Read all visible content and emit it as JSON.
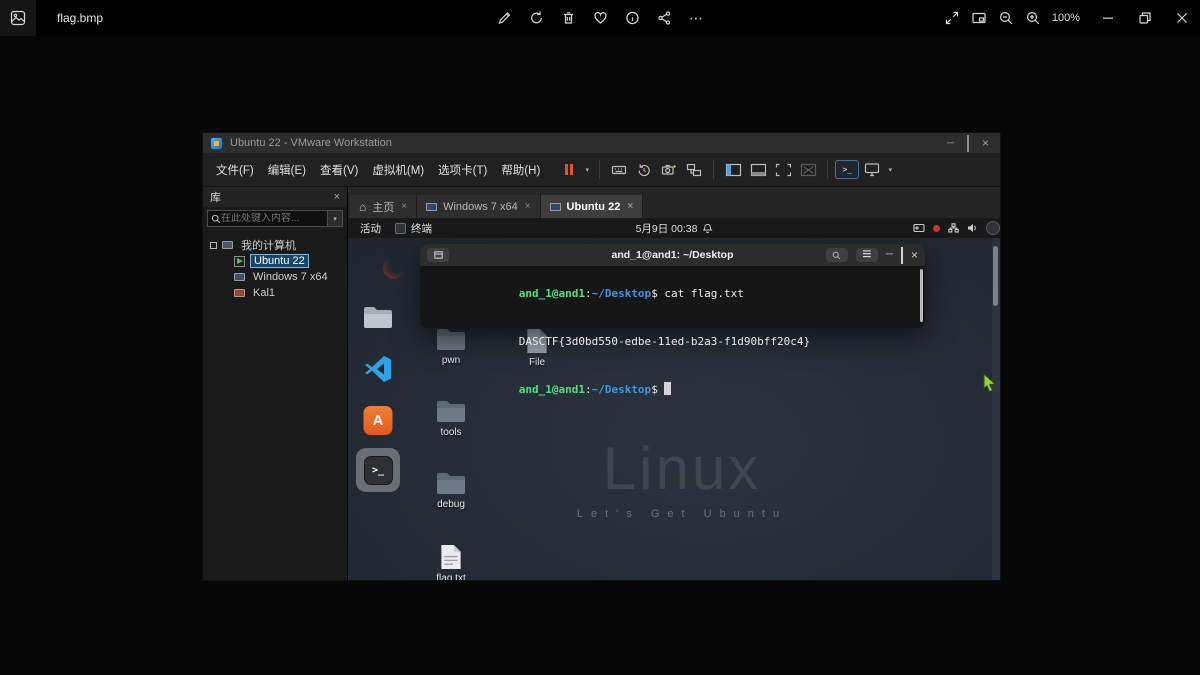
{
  "photos": {
    "title": "flag.bmp",
    "zoom_level": "100%"
  },
  "glyphs": {
    "more": "⋯",
    "caret": "▾",
    "home": "⌂",
    "tab_close": "×",
    "win_min": "─",
    "win_close": "×",
    "menu_icon": "≡",
    "prompt_icon": ">_",
    "lib_close": "×"
  },
  "vmware": {
    "title": "Ubuntu 22 - VMware Workstation",
    "menus": [
      "文件(F)",
      "编辑(E)",
      "查看(V)",
      "虚拟机(M)",
      "选项卡(T)",
      "帮助(H)"
    ],
    "sidebar": {
      "header": "库",
      "search_placeholder": "在此处键入内容...",
      "root": "我的计算机",
      "vms": [
        {
          "name": "Ubuntu 22",
          "state": "running",
          "selected": true
        },
        {
          "name": "Windows 7 x64"
        },
        {
          "name": "Kal1"
        }
      ]
    },
    "tabs": [
      {
        "label": "主页"
      },
      {
        "label": "Windows 7 x64"
      },
      {
        "label": "Ubuntu 22",
        "active": true
      }
    ]
  },
  "ubuntu": {
    "topbar": {
      "activities": "活动",
      "app_name": "终端",
      "clock": "5月9日 00:38"
    },
    "watermark": {
      "title": "Linux",
      "subtitle": "Let's Get Ubuntu"
    },
    "desktop_icons": [
      "pwn",
      "File",
      "tools",
      "debug",
      "flag.txt"
    ],
    "dock": [
      "firefox",
      "files",
      "vscode",
      "ubuntu-software",
      "terminal",
      "disc",
      "app"
    ],
    "terminal": {
      "title": "and_1@and1: ~/Desktop",
      "lines": [
        {
          "user": "and_1@and1",
          "sep": ":",
          "path": "~/Desktop",
          "dollar": "$",
          "cmd": " cat flag.txt"
        },
        {
          "output": "DASCTF{3d0bd550-edbe-11ed-b2a3-f1d90bff20c4}"
        },
        {
          "user": "and_1@and1",
          "sep": ":",
          "path": "~/Desktop",
          "dollar": "$",
          "cmd": " "
        }
      ]
    }
  }
}
